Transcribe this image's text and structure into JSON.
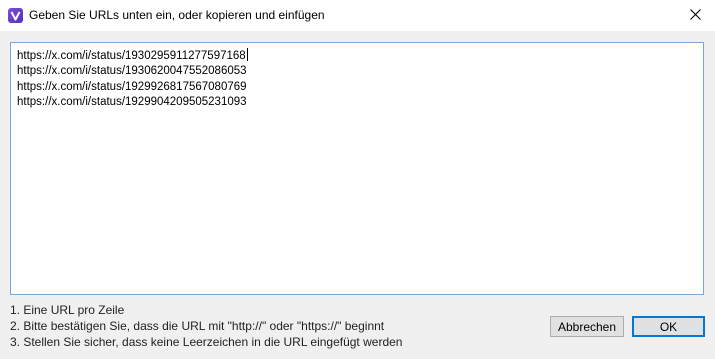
{
  "window": {
    "title": "Geben Sie URLs unten ein, oder kopieren und einfügen",
    "app_icon": "app-v-logo-icon",
    "close_icon": "close-icon"
  },
  "url_input": {
    "lines": [
      "https://x.com/i/status/1930295911277597168",
      "https://x.com/i/status/1930620047552086053",
      "https://x.com/i/status/1929926817567080769",
      "https://x.com/i/status/1929904209505231093"
    ]
  },
  "hints": [
    "1. Eine URL pro Zeile",
    "2. Bitte bestätigen Sie, dass die URL mit \"http://\" oder \"https://\" beginnt",
    "3. Stellen Sie sicher, dass keine Leerzeichen in die URL eingefügt werden"
  ],
  "buttons": {
    "cancel_label": "Abbrechen",
    "ok_label": "OK"
  },
  "colors": {
    "accent": "#0078d7",
    "app_icon": "#6a3fd0",
    "textarea_border": "#7aa7d1"
  }
}
